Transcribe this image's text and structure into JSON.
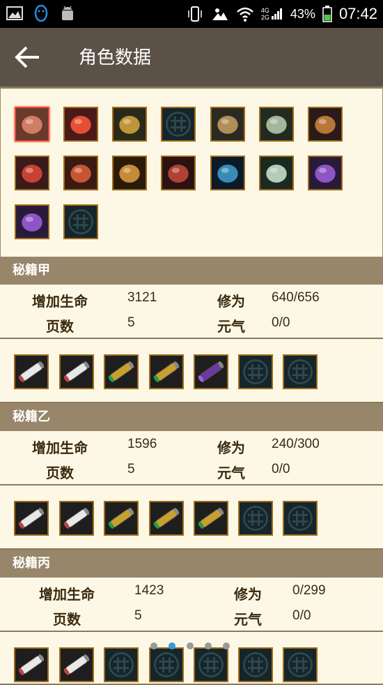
{
  "status_bar": {
    "battery_percent": "43%",
    "time": "07:42",
    "network_top": "4G",
    "network_bottom": "2G"
  },
  "app_bar": {
    "title": "角色数据"
  },
  "equipment": {
    "slots": [
      {
        "icon": "armor-equip-icon",
        "empty": false,
        "selected": true
      },
      {
        "icon": "flame-orb-equip-icon",
        "empty": false
      },
      {
        "icon": "mount-equip-icon",
        "empty": false
      },
      {
        "icon": "empty-slot-emblem-icon",
        "empty": true
      },
      {
        "icon": "hat-equip-icon",
        "empty": false
      },
      {
        "icon": "claw-equip-icon",
        "empty": false
      },
      {
        "icon": "beast-equip-icon",
        "empty": false
      },
      {
        "icon": "dragon-armor-equip-icon",
        "empty": false
      },
      {
        "icon": "red-armor-equip-icon",
        "empty": false
      },
      {
        "icon": "staff-equip-icon",
        "empty": false
      },
      {
        "icon": "boots-equip-icon",
        "empty": false
      },
      {
        "icon": "cape-equip-icon",
        "empty": false
      },
      {
        "icon": "fan-equip-icon",
        "empty": false
      },
      {
        "icon": "gourd-equip-icon",
        "empty": false
      },
      {
        "icon": "gourd-equip-icon",
        "empty": false
      },
      {
        "icon": "empty-slot-emblem-icon",
        "empty": true
      }
    ]
  },
  "sections": [
    {
      "name": "秘籍甲",
      "life_label": "增加生命",
      "life_value": "3121",
      "cultivation_label": "修为",
      "cultivation_value": "640/656",
      "pages_label": "页数",
      "pages_value": "5",
      "vitality_label": "元气",
      "vitality_value": "0/0",
      "scrolls": [
        "white",
        "white",
        "green",
        "green",
        "purple",
        "empty",
        "empty"
      ]
    },
    {
      "name": "秘籍乙",
      "life_label": "增加生命",
      "life_value": "1596",
      "cultivation_label": "修为",
      "cultivation_value": "240/300",
      "pages_label": "页数",
      "pages_value": "5",
      "vitality_label": "元气",
      "vitality_value": "0/0",
      "scrolls": [
        "white",
        "white",
        "green",
        "green",
        "green",
        "empty",
        "empty"
      ]
    },
    {
      "name": "秘籍丙",
      "life_label": "增加生命",
      "life_value": "1423",
      "cultivation_label": "修为",
      "cultivation_value": "0/299",
      "pages_label": "页数",
      "pages_value": "5",
      "vitality_label": "元气",
      "vitality_value": "0/0",
      "scrolls": [
        "white",
        "white",
        "empty",
        "empty",
        "empty",
        "empty",
        "empty"
      ]
    }
  ],
  "pager": {
    "count": 5,
    "active_index": 1
  },
  "colors": {
    "app_bar": "#5b5146",
    "section_header": "#98866a",
    "background": "#fdf8e6",
    "slot_border": "#a06a1a",
    "active_dot": "#2aa0e0"
  }
}
